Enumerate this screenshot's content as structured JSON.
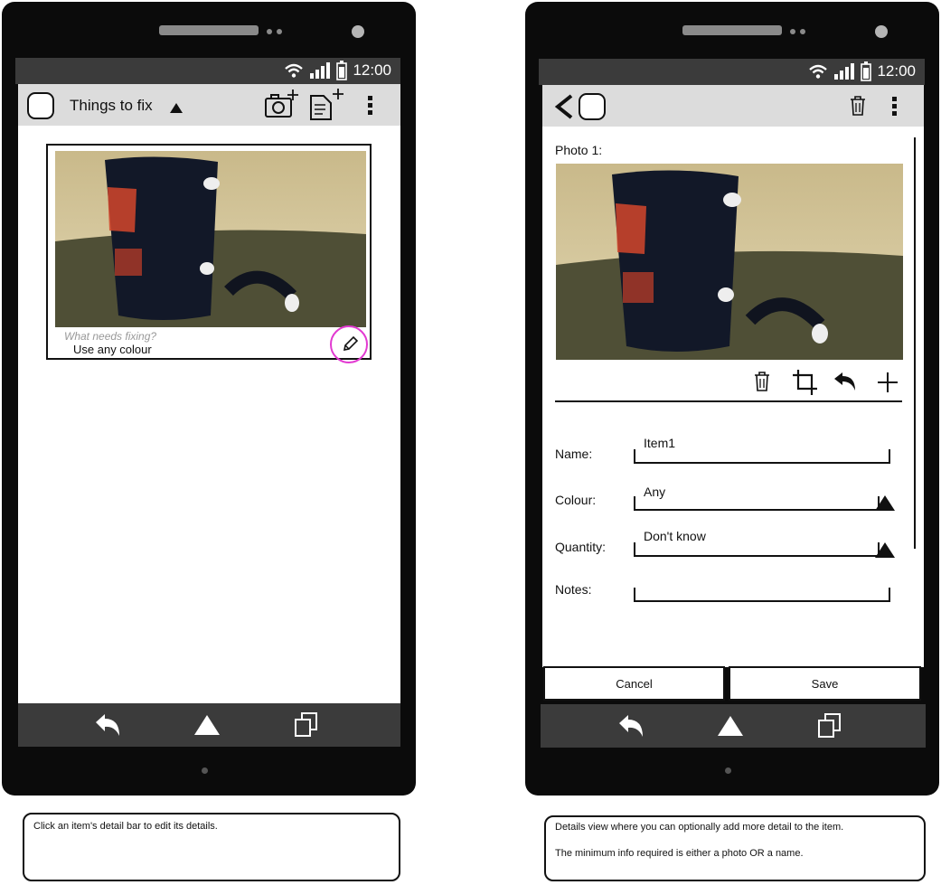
{
  "status_bar": {
    "time": "12:00"
  },
  "screen1": {
    "title": "Things to fix",
    "item": {
      "hint": "What needs fixing?",
      "value": "Use any colour"
    }
  },
  "screen2": {
    "photo_label": "Photo 1:",
    "form": {
      "name_label": "Name:",
      "name_value": "Item1",
      "colour_label": "Colour:",
      "colour_value": "Any",
      "quantity_label": "Quantity:",
      "quantity_value": "Don't know",
      "notes_label": "Notes:"
    },
    "buttons": {
      "cancel": "Cancel",
      "save": "Save"
    }
  },
  "notes": {
    "left": "Click an item's detail bar to edit its details.",
    "right_line1": "Details view where you can optionally add more detail to the item.",
    "right_line2": "The minimum info required is either a photo OR a name."
  },
  "colors": {
    "highlight": "#e23ad1",
    "status_bar": "#3b3b3b",
    "action_bar": "#dcdcdc"
  }
}
